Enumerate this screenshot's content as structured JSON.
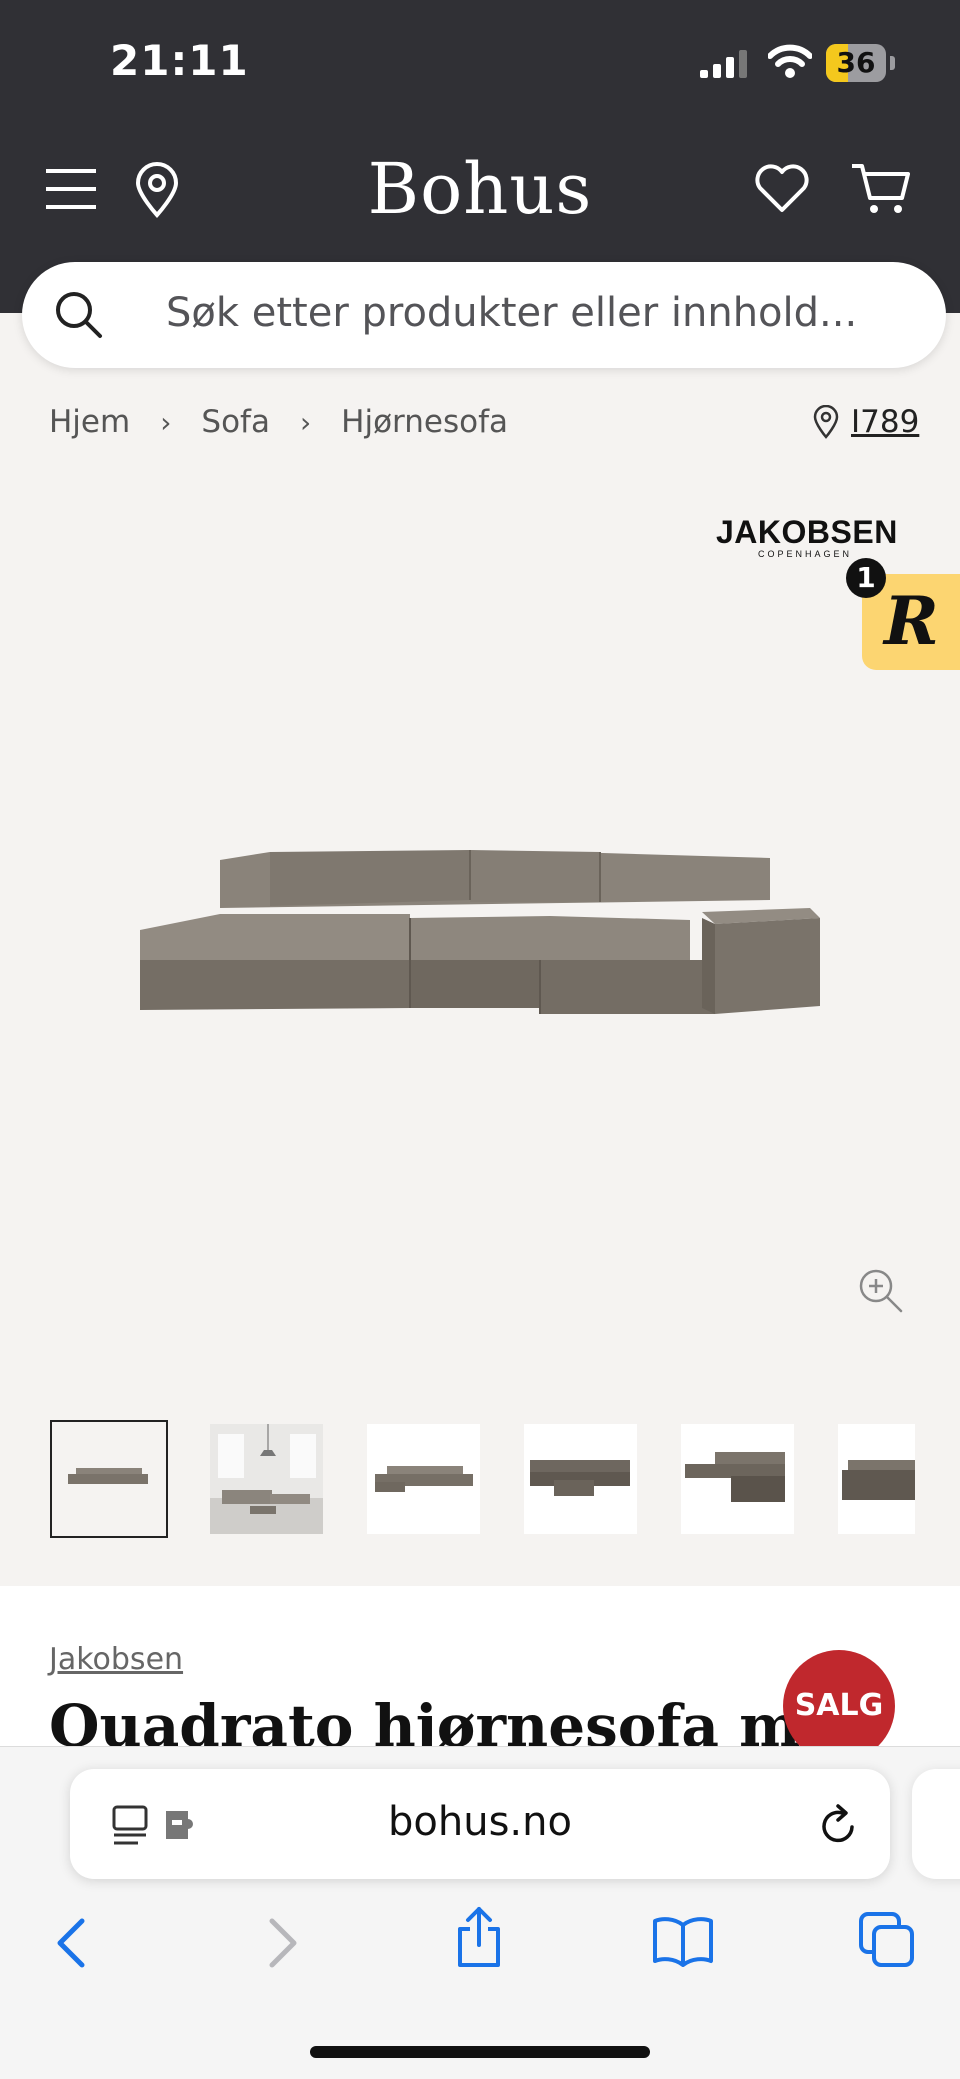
{
  "status_bar": {
    "time": "21:11",
    "battery": "36"
  },
  "header": {
    "logo": "Bohus",
    "icons": [
      "menu-icon",
      "location-pin-icon",
      "heart-icon",
      "cart-icon"
    ]
  },
  "search": {
    "placeholder": "Søk etter produkter eller innhold..."
  },
  "breadcrumb": {
    "items": [
      "Hjem",
      "Sofa",
      "Hjørnesofa"
    ],
    "store": "I789"
  },
  "product": {
    "brand_logo": {
      "name": "JAKOBSEN",
      "sub": "COPENHAGEN"
    },
    "widget_badge": "1",
    "widget_letter": "R",
    "thumbnails": 6,
    "brand": "Jakobsen",
    "title": "Quadrato hjørnesofa med",
    "sale_badge": "SALG"
  },
  "browser": {
    "url": "bohus.no"
  },
  "colors": {
    "header_bg": "#303035",
    "page_bg": "#f5f3f1",
    "sale": "#c0282d",
    "widget": "#fcd571",
    "link_blue": "#1a73e8"
  }
}
